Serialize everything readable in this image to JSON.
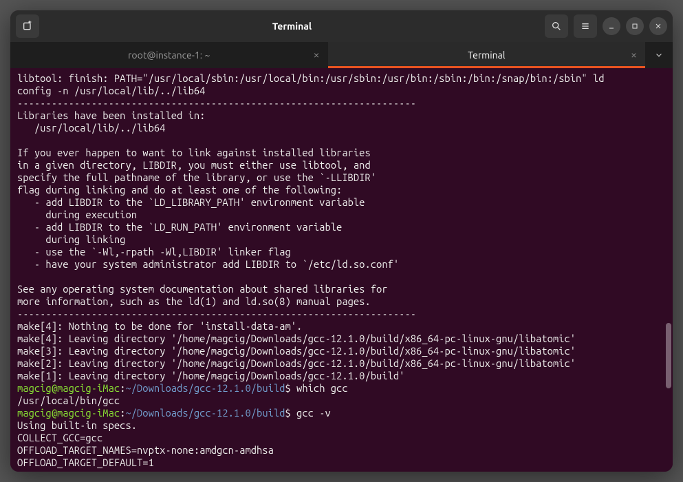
{
  "window": {
    "title": "Terminal"
  },
  "tabs": [
    {
      "label": "root@instance-1: ~",
      "active": false
    },
    {
      "label": "Terminal",
      "active": true
    }
  ],
  "terminal": {
    "lines": [
      "libtool: finish: PATH=\"/usr/local/sbin:/usr/local/bin:/usr/sbin:/usr/bin:/sbin:/bin:/snap/bin:/sbin\" ld",
      "config -n /usr/local/lib/../lib64",
      "----------------------------------------------------------------------",
      "Libraries have been installed in:",
      "   /usr/local/lib/../lib64",
      "",
      "If you ever happen to want to link against installed libraries",
      "in a given directory, LIBDIR, you must either use libtool, and",
      "specify the full pathname of the library, or use the `-LLIBDIR'",
      "flag during linking and do at least one of the following:",
      "   - add LIBDIR to the `LD_LIBRARY_PATH' environment variable",
      "     during execution",
      "   - add LIBDIR to the `LD_RUN_PATH' environment variable",
      "     during linking",
      "   - use the `-Wl,-rpath -Wl,LIBDIR' linker flag",
      "   - have your system administrator add LIBDIR to `/etc/ld.so.conf'",
      "",
      "See any operating system documentation about shared libraries for",
      "more information, such as the ld(1) and ld.so(8) manual pages.",
      "----------------------------------------------------------------------",
      "make[4]: Nothing to be done for 'install-data-am'.",
      "make[4]: Leaving directory '/home/magcig/Downloads/gcc-12.1.0/build/x86_64-pc-linux-gnu/libatomic'",
      "make[3]: Leaving directory '/home/magcig/Downloads/gcc-12.1.0/build/x86_64-pc-linux-gnu/libatomic'",
      "make[2]: Leaving directory '/home/magcig/Downloads/gcc-12.1.0/build/x86_64-pc-linux-gnu/libatomic'",
      "make[1]: Leaving directory '/home/magcig/Downloads/gcc-12.1.0/build'"
    ],
    "prompt1": {
      "user": "magcig@magcig-iMac",
      "path": "~/Downloads/gcc-12.1.0/build",
      "cmd": "which gcc"
    },
    "output1": "/usr/local/bin/gcc",
    "prompt2": {
      "user": "magcig@magcig-iMac",
      "path": "~/Downloads/gcc-12.1.0/build",
      "cmd": "gcc -v"
    },
    "output2_lines": [
      "Using built-in specs.",
      "COLLECT_GCC=gcc",
      "OFFLOAD_TARGET_NAMES=nvptx-none:amdgcn-amdhsa",
      "OFFLOAD_TARGET_DEFAULT=1"
    ]
  }
}
